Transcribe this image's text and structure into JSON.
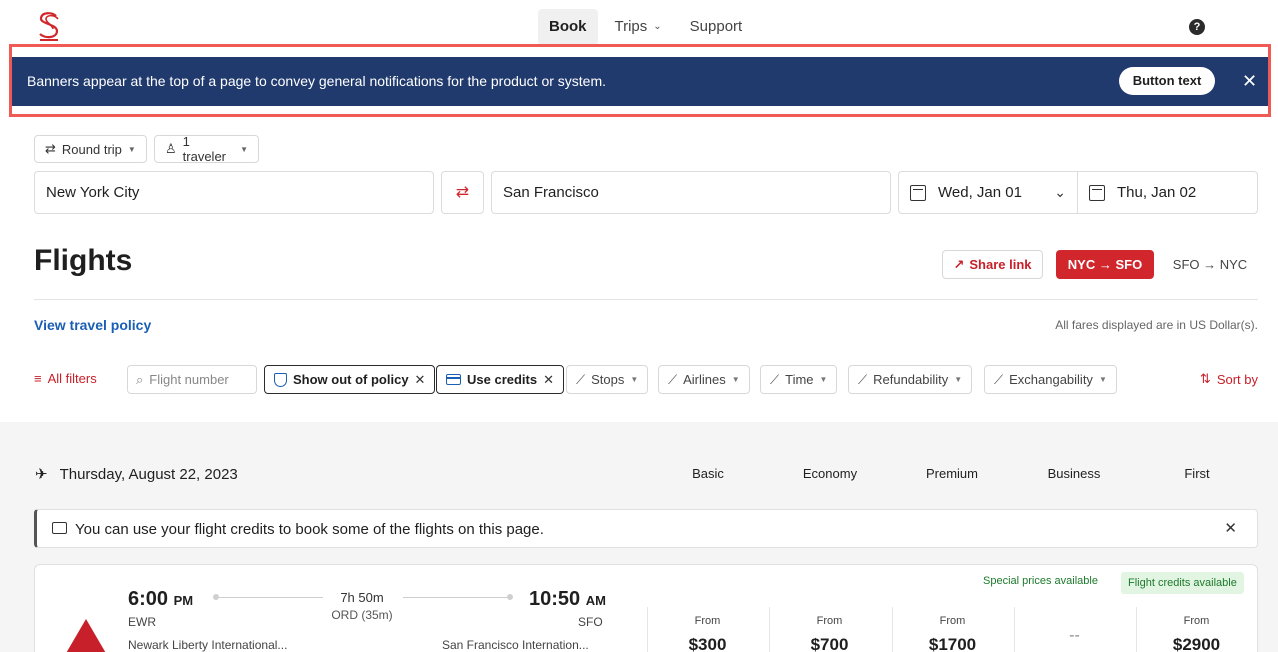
{
  "nav": {
    "items": [
      {
        "label": "Book",
        "active": true
      },
      {
        "label": "Trips",
        "active": false
      },
      {
        "label": "Support",
        "active": false
      }
    ],
    "help_symbol": "?"
  },
  "banner": {
    "text": "Banners appear at the top of a page to convey general notifications for the product or system.",
    "button_label": "Button text",
    "close_symbol": "✕"
  },
  "search": {
    "trip_type": "Round trip",
    "travelers": "1 traveler",
    "origin": "New York City",
    "destination": "San Francisco",
    "depart_date": "Wed, Jan 01",
    "return_date": "Thu, Jan 02"
  },
  "flights": {
    "title": "Flights",
    "share_label": "Share link",
    "route_active": "NYC → SFO",
    "route_other": "SFO → NYC",
    "policy_link": "View travel policy",
    "fares_note": "All fares displayed are in US Dollar(s)."
  },
  "filters": {
    "all_filters": "All filters",
    "flight_number_placeholder": "Flight number",
    "show_out_of_policy": "Show out of policy",
    "use_credits": "Use credits",
    "stops": "Stops",
    "airlines": "Airlines",
    "time": "Time",
    "refundability": "Refundability",
    "exchangability": "Exchangability",
    "sort_by": "Sort by"
  },
  "results": {
    "date": "Thursday, August 22, 2023",
    "cabins": [
      "Basic",
      "Economy",
      "Premium",
      "Business",
      "First"
    ],
    "credit_notice": "You can use your flight credits to book some of the flights on this page.",
    "flight": {
      "dep_time": "6:00",
      "dep_ampm": "PM",
      "arr_time": "10:50",
      "arr_ampm": "AM",
      "duration": "7h 50m",
      "stop": "ORD (35m)",
      "dep_code": "EWR",
      "arr_code": "SFO",
      "dep_airport": "Newark Liberty International...",
      "arr_airport": "San Francisco Internation...",
      "tag_special": "Special prices available",
      "tag_credits": "Flight credits available",
      "prices": [
        {
          "from": "From",
          "price": "$300"
        },
        {
          "from": "From",
          "price": "$700"
        },
        {
          "from": "From",
          "price": "$1700"
        },
        {
          "from": "",
          "price": "--"
        },
        {
          "from": "From",
          "price": "$2900"
        }
      ]
    }
  },
  "colors": {
    "brand_red": "#d0262c",
    "banner_navy": "#213a6e",
    "link_blue": "#1a5fb4",
    "success_green": "#1d7a2c"
  }
}
